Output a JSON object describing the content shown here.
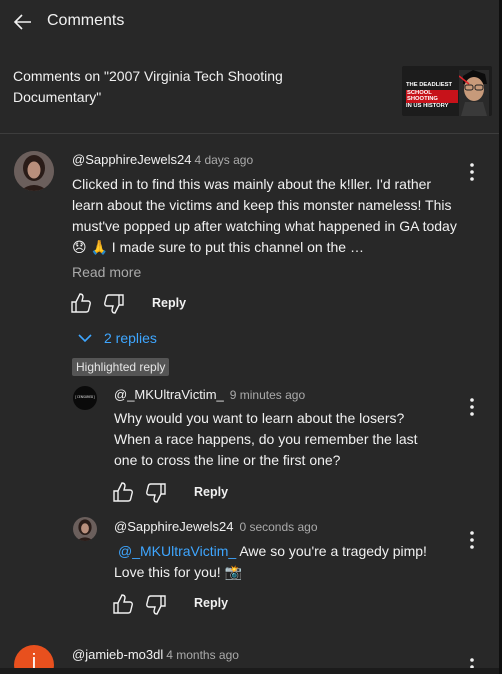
{
  "header": {
    "title": "Comments"
  },
  "context": {
    "label": "Comments on \"2007 Virginia Tech Shooting Documentary\"",
    "thumbnail_caption": [
      "The deadliest",
      "school shooting",
      "in US history"
    ]
  },
  "comments": [
    {
      "handle": "@SapphireJewels24",
      "time": "4 days ago",
      "text": "Clicked in to find this was mainly about the k!ller. I'd rather learn about the victims and keep this monster nameless! This must've popped up after watching what happened in GA today 😞  🙏  I made sure to put this channel on the …",
      "read_more": "Read more",
      "reply_label": "Reply",
      "replies_toggle": "2 replies"
    }
  ],
  "highlighted_label": "Highlighted reply",
  "replies": [
    {
      "handle": "@_MKUltraVictim_",
      "time": "9 minutes ago",
      "avatar_text": "[CENSORED]",
      "text": "Why would you want to learn about the losers? When a race happens, do you remember the last one to cross the line or the first one?",
      "reply_label": "Reply"
    },
    {
      "handle": "@SapphireJewels24",
      "time": "0 seconds ago",
      "mention": "@_MKUltraVictim_",
      "text": " Awe so you're a tragedy pimp! Love this for you! 📸",
      "reply_label": "Reply"
    }
  ],
  "next_comment": {
    "handle": "@jamieb-mo3dl",
    "time": "4 months ago",
    "avatar_letter": "j"
  },
  "colors": {
    "panel": "#282828",
    "link": "#3ea6ff",
    "avatar_orange": "#e8501e",
    "badge": "#555555"
  }
}
